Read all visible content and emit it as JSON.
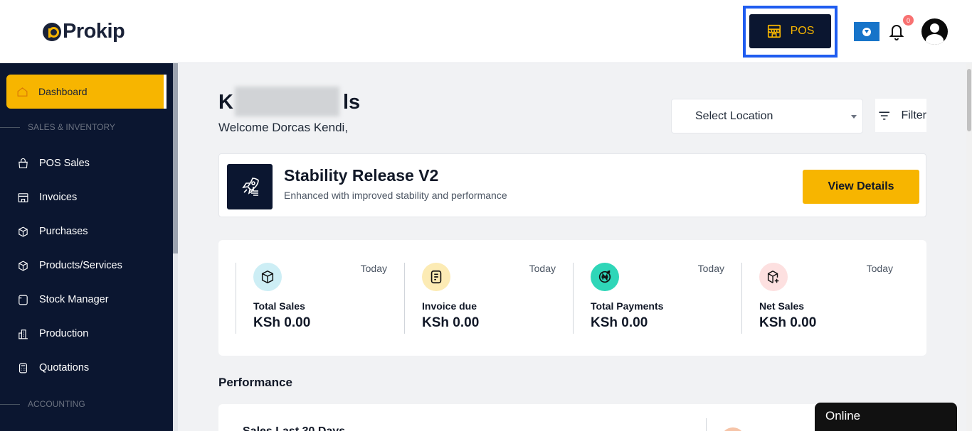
{
  "header": {
    "logo_text": "Prokip",
    "pos_label": "POS",
    "notification_count": "0"
  },
  "sidebar": {
    "active": {
      "label": "Dashboard",
      "icon": "home-icon"
    },
    "sections": [
      {
        "label": "SALES & INVENTORY"
      },
      {
        "label": "ACCOUNTING"
      }
    ],
    "items": [
      {
        "label": "POS Sales",
        "icon": "bag-icon"
      },
      {
        "label": "Invoices",
        "icon": "store-icon"
      },
      {
        "label": "Purchases",
        "icon": "box-icon"
      },
      {
        "label": "Products/Services",
        "icon": "cube-icon"
      },
      {
        "label": "Stock Manager",
        "icon": "stock-icon"
      },
      {
        "label": "Production",
        "icon": "factory-icon"
      },
      {
        "label": "Quotations",
        "icon": "calculator-icon"
      }
    ]
  },
  "main": {
    "business_name_start": "K",
    "business_name_end": "ls",
    "welcome": "Welcome Dorcas Kendi,",
    "location_placeholder": "Select Location",
    "filter_label": "Filter",
    "release": {
      "title": "Stability Release V2",
      "subtitle": "Enhanced with improved stability and performance",
      "button": "View Details"
    },
    "stats": [
      {
        "label": "Total Sales",
        "value": "KSh 0.00",
        "period": "Today",
        "icon": "cube-icon",
        "color": "#cdeef5"
      },
      {
        "label": "Invoice due",
        "value": "KSh 0.00",
        "period": "Today",
        "icon": "invoice-icon",
        "color": "#fcebb4"
      },
      {
        "label": "Total Payments",
        "value": "KSh 0.00",
        "period": "Today",
        "icon": "payment-icon",
        "color": "#2fd6b8"
      },
      {
        "label": "Net Sales",
        "value": "KSh 0.00",
        "period": "Today",
        "icon": "box-plus-icon",
        "color": "#fde0e0"
      }
    ],
    "performance_title": "Performance",
    "performance_card_title": "Sales Last 30 Days"
  },
  "chat": {
    "status": "Online"
  },
  "colors": {
    "accent": "#f7b500",
    "navy": "#0b1630",
    "focus": "#1f5cf0"
  }
}
